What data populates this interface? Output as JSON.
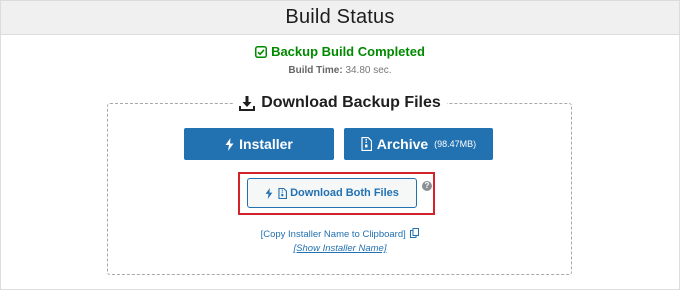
{
  "header": {
    "title": "Build Status"
  },
  "status": {
    "message": "Backup Build Completed",
    "build_time_label": "Build Time:",
    "build_time_value": "34.80 sec."
  },
  "download_section": {
    "title": "Download Backup Files",
    "installer_label": "Installer",
    "archive_label": "Archive",
    "archive_size": "(98.47MB)",
    "both_label": "Download Both Files",
    "help_symbol": "?",
    "copy_link": "[Copy Installer Name to Clipboard]",
    "show_link": "[Show Installer Name]"
  },
  "colors": {
    "success": "#008a00",
    "primary": "#2271b1",
    "highlight": "#d2232a"
  },
  "icons": [
    "check-square-icon",
    "download-icon",
    "bolt-icon",
    "file-zip-icon",
    "help-icon",
    "copy-icon"
  ]
}
